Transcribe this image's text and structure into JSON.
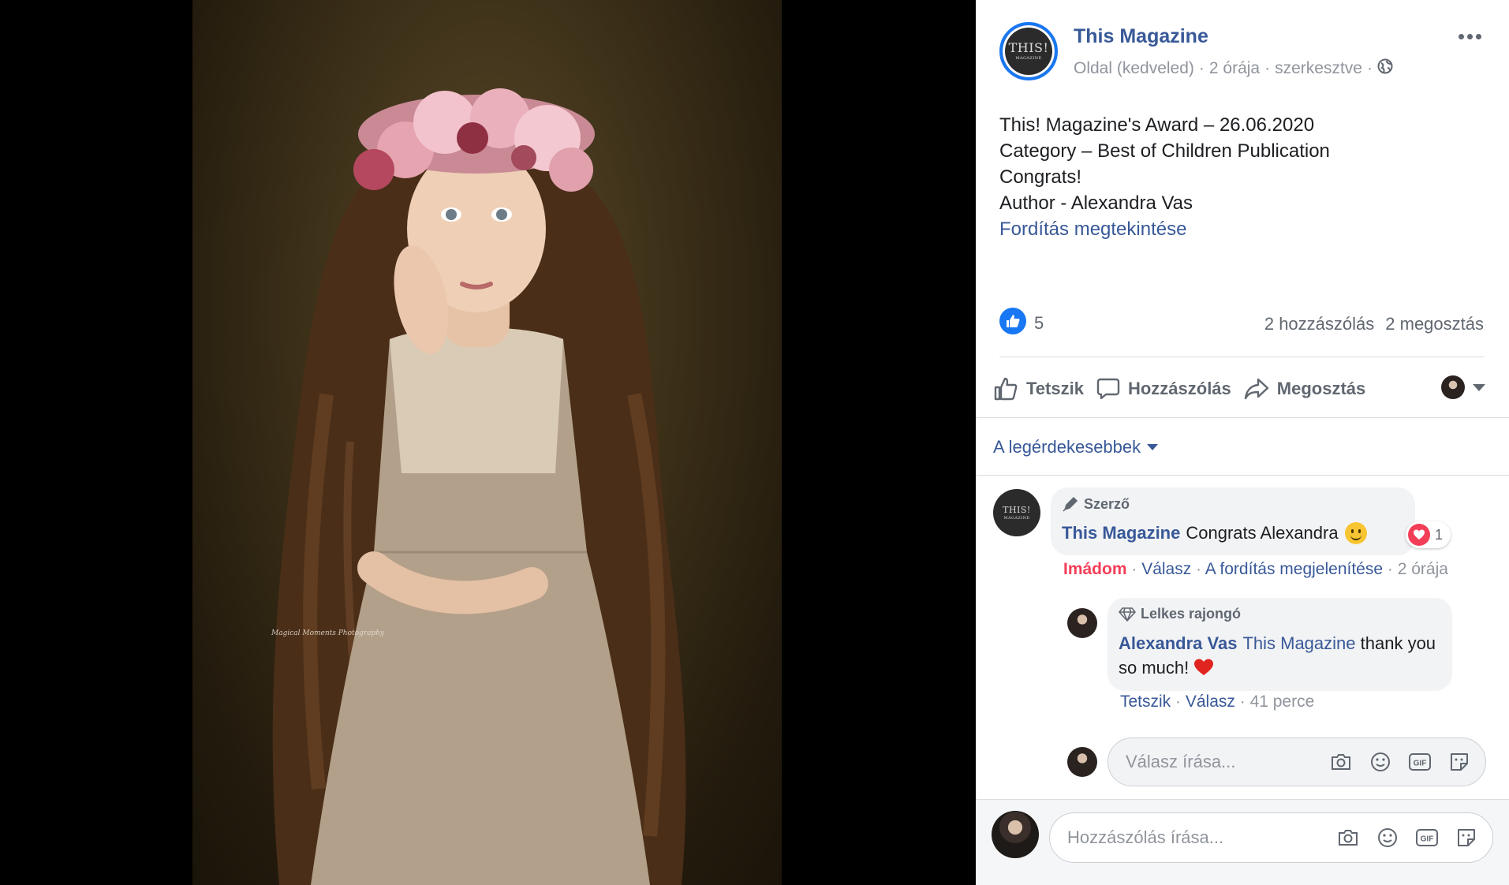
{
  "post": {
    "page_name": "This Magazine",
    "avatar_text": "THIS!",
    "avatar_subtext": "MAGAZINE",
    "meta": [
      "Oldal (kedveled)",
      "·",
      "2 órája",
      "·",
      "szerkesztve",
      "·"
    ],
    "lines": [
      "This! Magazine's Award – 26.06.2020",
      "Category – Best of Children Publication",
      "Congrats!",
      "Author - Alexandra Vas"
    ],
    "translate_link": "Fordítás megtekintése",
    "like_count": "5",
    "comments_count": "2 hozzászólás",
    "shares_count": "2 megosztás"
  },
  "actions": {
    "like": "Tetszik",
    "comment": "Hozzászólás",
    "share": "Megosztás"
  },
  "sort_label": "A legérdekesebbek",
  "comments": [
    {
      "badge": "Szerző",
      "author": "This Magazine",
      "text": "Congrats Alexandra",
      "reaction_count": "1",
      "reaction_label": "Imádom",
      "reply_label": "Válasz",
      "translate_label": "A fordítás megjelenítése",
      "time": "2 órája"
    },
    {
      "badge": "Lelkes rajongó",
      "author": "Alexandra Vas",
      "tag": "This Magazine",
      "text": "thank you so much!",
      "like_label": "Tetszik",
      "reply_label": "Válasz",
      "time": "41 perce"
    }
  ],
  "reply_input": {
    "placeholder": "Válasz írása..."
  },
  "comment_input": {
    "placeholder": "Hozzászólás írása..."
  },
  "photo": {
    "watermark": "Magical Moments Photography"
  },
  "colors": {
    "link": "#385898",
    "accent": "#1877f2",
    "love": "#f33e58",
    "muted": "#90949c"
  },
  "icons": [
    "more-icon",
    "globe-icon",
    "like-icon",
    "comment-icon",
    "share-icon",
    "caret-down-icon",
    "pen-icon",
    "diamond-icon",
    "heart-icon",
    "camera-icon",
    "emoji-icon",
    "gif-icon",
    "sticker-icon"
  ]
}
